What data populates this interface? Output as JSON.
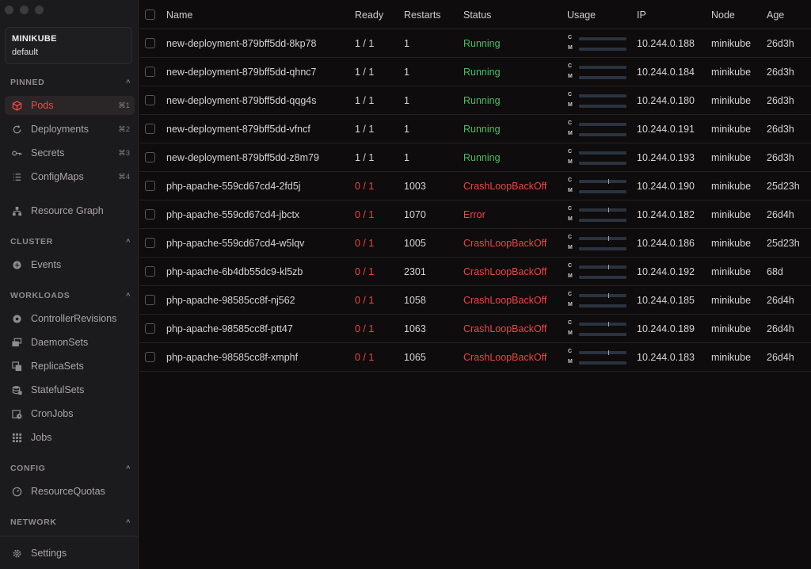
{
  "sidebar": {
    "cluster": {
      "name": "MINIKUBE",
      "namespace": "default"
    },
    "sections": {
      "pinned": "PINNED",
      "cluster": "CLUSTER",
      "workloads": "WORKLOADS",
      "config": "CONFIG",
      "network": "NETWORK"
    },
    "pinned_items": [
      {
        "label": "Pods",
        "shortcut": "⌘1",
        "icon": "cube-icon"
      },
      {
        "label": "Deployments",
        "shortcut": "⌘2",
        "icon": "cycle-icon"
      },
      {
        "label": "Secrets",
        "shortcut": "⌘3",
        "icon": "key-icon"
      },
      {
        "label": "ConfigMaps",
        "shortcut": "⌘4",
        "icon": "list-icon"
      }
    ],
    "resource_graph": "Resource Graph",
    "cluster_items": [
      {
        "label": "Events"
      }
    ],
    "workload_items": [
      {
        "label": "ControllerRevisions"
      },
      {
        "label": "DaemonSets"
      },
      {
        "label": "ReplicaSets"
      },
      {
        "label": "StatefulSets"
      },
      {
        "label": "CronJobs"
      },
      {
        "label": "Jobs"
      }
    ],
    "config_items": [
      {
        "label": "ResourceQuotas"
      }
    ],
    "settings": "Settings"
  },
  "table": {
    "columns": {
      "name": "Name",
      "ready": "Ready",
      "restarts": "Restarts",
      "status": "Status",
      "usage": "Usage",
      "ip": "IP",
      "node": "Node",
      "age": "Age"
    },
    "usage_labels": {
      "cpu": "C",
      "mem": "M"
    },
    "rows": [
      {
        "name": "new-deployment-879bff5dd-8kp78",
        "ready": "1 / 1",
        "restarts": "1",
        "status": "Running",
        "ip": "10.244.0.188",
        "node": "minikube",
        "age": "26d3h"
      },
      {
        "name": "new-deployment-879bff5dd-qhnc7",
        "ready": "1 / 1",
        "restarts": "1",
        "status": "Running",
        "ip": "10.244.0.184",
        "node": "minikube",
        "age": "26d3h"
      },
      {
        "name": "new-deployment-879bff5dd-qqg4s",
        "ready": "1 / 1",
        "restarts": "1",
        "status": "Running",
        "ip": "10.244.0.180",
        "node": "minikube",
        "age": "26d3h"
      },
      {
        "name": "new-deployment-879bff5dd-vfncf",
        "ready": "1 / 1",
        "restarts": "1",
        "status": "Running",
        "ip": "10.244.0.191",
        "node": "minikube",
        "age": "26d3h"
      },
      {
        "name": "new-deployment-879bff5dd-z8m79",
        "ready": "1 / 1",
        "restarts": "1",
        "status": "Running",
        "ip": "10.244.0.193",
        "node": "minikube",
        "age": "26d3h"
      },
      {
        "name": "php-apache-559cd67cd4-2fd5j",
        "ready": "0 / 1",
        "restarts": "1003",
        "status": "CrashLoopBackOff",
        "ip": "10.244.0.190",
        "node": "minikube",
        "age": "25d23h"
      },
      {
        "name": "php-apache-559cd67cd4-jbctx",
        "ready": "0 / 1",
        "restarts": "1070",
        "status": "Error",
        "ip": "10.244.0.182",
        "node": "minikube",
        "age": "26d4h"
      },
      {
        "name": "php-apache-559cd67cd4-w5lqv",
        "ready": "0 / 1",
        "restarts": "1005",
        "status": "CrashLoopBackOff",
        "ip": "10.244.0.186",
        "node": "minikube",
        "age": "25d23h"
      },
      {
        "name": "php-apache-6b4db55dc9-kl5zb",
        "ready": "0 / 1",
        "restarts": "2301",
        "status": "CrashLoopBackOff",
        "ip": "10.244.0.192",
        "node": "minikube",
        "age": "68d"
      },
      {
        "name": "php-apache-98585cc8f-nj562",
        "ready": "0 / 1",
        "restarts": "1058",
        "status": "CrashLoopBackOff",
        "ip": "10.244.0.185",
        "node": "minikube",
        "age": "26d4h"
      },
      {
        "name": "php-apache-98585cc8f-ptt47",
        "ready": "0 / 1",
        "restarts": "1063",
        "status": "CrashLoopBackOff",
        "ip": "10.244.0.189",
        "node": "minikube",
        "age": "26d4h"
      },
      {
        "name": "php-apache-98585cc8f-xmphf",
        "ready": "0 / 1",
        "restarts": "1065",
        "status": "CrashLoopBackOff",
        "ip": "10.244.0.183",
        "node": "minikube",
        "age": "26d4h"
      }
    ]
  },
  "colors": {
    "accent": "#f04a4a",
    "running": "#4cbd66",
    "error": "#ef4545"
  }
}
